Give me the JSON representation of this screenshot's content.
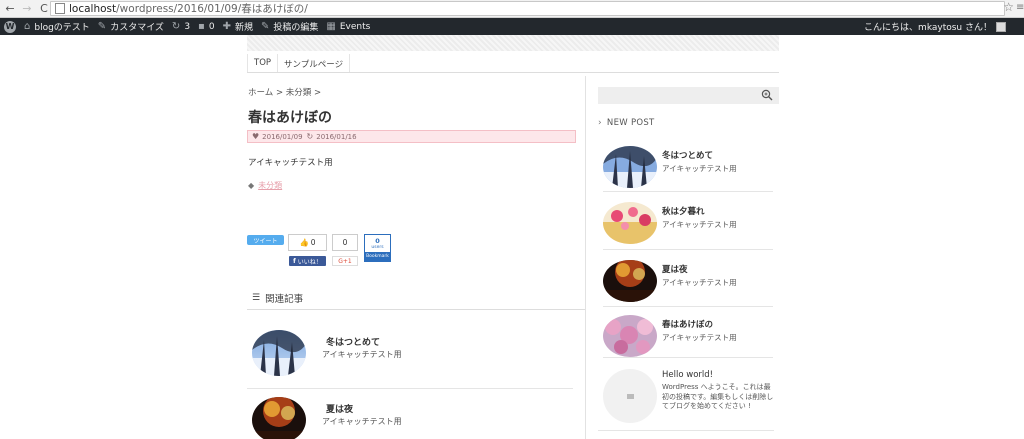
{
  "browser": {
    "url_host": "localhost",
    "url_path": "/wordpress/2016/01/09/春はあけぼの/",
    "back_icon": "←",
    "forward_icon": "→",
    "reload_icon": "C",
    "star_icon": "☆",
    "menu_icon": "≡"
  },
  "adminbar": {
    "site_name": "blogのテスト",
    "customize": "カスタマイズ",
    "updates_count": "3",
    "comments_count": "0",
    "new_label": "新規",
    "edit_label": "投稿の編集",
    "events_label": "Events",
    "greeting": "こんにちは、mkaytosu さん！"
  },
  "nav": {
    "items": [
      "TOP",
      "サンプルページ"
    ]
  },
  "article": {
    "breadcrumb": "ホーム > 未分類 >",
    "title": "春はあけぼの",
    "published": "2016/01/09",
    "modified": "2016/01/16",
    "body": "アイキャッチテスト用",
    "category": "未分類"
  },
  "share": {
    "tweet_label": "ツイート",
    "like_count": "0",
    "share_count": "0",
    "fb_label": "いいね！",
    "gplus_label": "G+1",
    "hatena_count": "0",
    "hatena_users": "users",
    "hatena_label": "Bookmark"
  },
  "related": {
    "heading": "関連記事",
    "items": [
      {
        "title": "冬はつとめて",
        "excerpt": "アイキャッチテスト用"
      },
      {
        "title": "夏は夜",
        "excerpt": "アイキャッチテスト用"
      }
    ]
  },
  "sidebar": {
    "heading": "NEW POST",
    "posts": [
      {
        "title": "冬はつとめて",
        "excerpt": "アイキャッチテスト用"
      },
      {
        "title": "秋は夕暮れ",
        "excerpt": "アイキャッチテスト用"
      },
      {
        "title": "夏は夜",
        "excerpt": "アイキャッチテスト用"
      },
      {
        "title": "春はあけぼの",
        "excerpt": "アイキャッチテスト用"
      }
    ],
    "hello": {
      "title": "Hello world!",
      "excerpt": "WordPress へようこそ。これは最初の投稿です。編集もしくは削除してブログを始めてください !"
    }
  },
  "colors": {
    "adminbar_bg": "#23282d",
    "meta_bg": "#fde7ea",
    "accent_pink": "#e7a0ab",
    "twitter": "#55acee",
    "facebook": "#3b5998",
    "hatena": "#2c6ebd"
  }
}
